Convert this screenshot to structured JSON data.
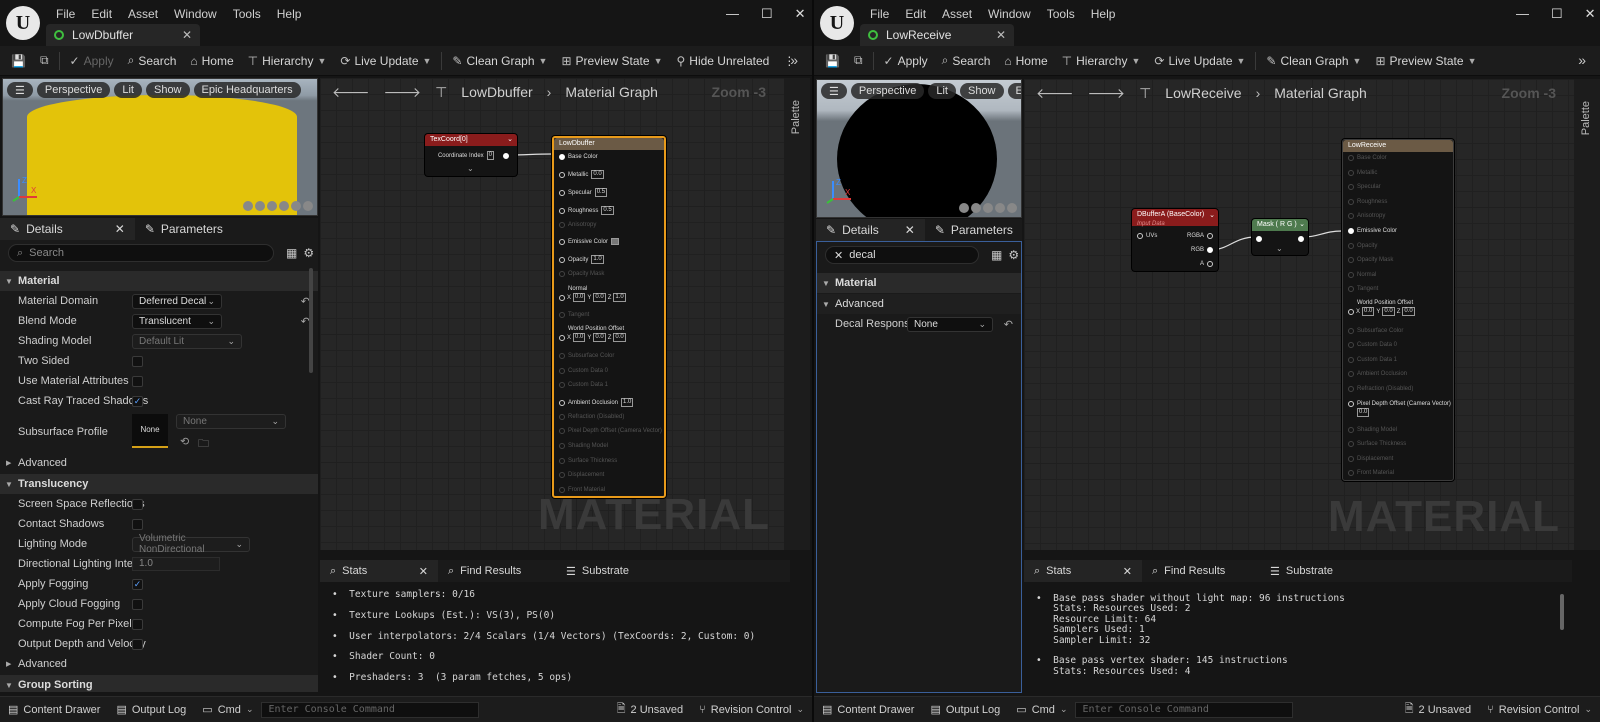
{
  "menu": [
    "File",
    "Edit",
    "Asset",
    "Window",
    "Tools",
    "Help"
  ],
  "window_controls": {
    "minimize": "—",
    "maximize": "☐",
    "close": "✕"
  },
  "left": {
    "tab_title": "LowDbuffer",
    "toolbar": {
      "apply": "Apply",
      "search": "Search",
      "home": "Home",
      "hierarchy": "Hierarchy",
      "live_update": "Live Update",
      "clean_graph": "Clean Graph",
      "preview_state": "Preview State",
      "hide_unrelated": "Hide Unrelated"
    },
    "viewport": {
      "perspective": "Perspective",
      "lit": "Lit",
      "show": "Show",
      "extra": "Epic Headquarters",
      "preview_color": "#e3c30a"
    },
    "details_tab": "Details",
    "parameters_tab": "Parameters",
    "search_placeholder": "Search",
    "cat_material": "Material",
    "material_domain_label": "Material Domain",
    "material_domain_value": "Deferred Decal",
    "blend_mode_label": "Blend Mode",
    "blend_mode_value": "Translucent",
    "shading_model_label": "Shading Model",
    "shading_model_value": "Default Lit",
    "two_sided_label": "Two Sided",
    "use_attrs_label": "Use Material Attributes",
    "cast_rt_label": "Cast Ray Traced Shadows",
    "subsurface_label": "Subsurface Profile",
    "subsurface_thumb": "None",
    "subsurface_value": "None",
    "advanced1": "Advanced",
    "cat_translucency": "Translucency",
    "ssr_label": "Screen Space Reflections",
    "contact_label": "Contact Shadows",
    "lighting_mode_label": "Lighting Mode",
    "lighting_mode_value": "Volumetric NonDirectional",
    "dir_light_label": "Directional Lighting Intensity",
    "dir_light_value": "1.0",
    "apply_fog_label": "Apply Fogging",
    "cloud_fog_label": "Apply Cloud Fogging",
    "fog_pixel_label": "Compute Fog Per Pixel",
    "output_depth_label": "Output Depth and Velocity",
    "advanced2": "Advanced",
    "cat_group_sorting": "Group Sorting",
    "breadcrumb_asset": "LowDbuffer",
    "breadcrumb_graph": "Material Graph",
    "zoom": "Zoom -3",
    "palette": "Palette",
    "watermark": "MATERIAL",
    "texcoord": {
      "title": "TexCoord[0]",
      "coordinate_index": "Coordinate Index",
      "ci_value": "0"
    },
    "main_node": {
      "title": "LowDbuffer",
      "base_color": "Base Color",
      "metallic": "Metallic",
      "metallic_v": "0.0",
      "specular": "Specular",
      "specular_v": "0.5",
      "roughness": "Roughness",
      "roughness_v": "0.5",
      "anisotropy": "Anisotropy",
      "emissive": "Emissive Color",
      "opacity": "Opacity",
      "opacity_v": "1.0",
      "opacity_mask": "Opacity Mask",
      "normal": "Normal",
      "nx": "0.0",
      "ny": "0.0",
      "nz": "1.0",
      "tangent": "Tangent",
      "wpo": "World Position Offset",
      "wx": "0.0",
      "wy": "0.0",
      "wz": "0.0",
      "subsurface": "Subsurface Color",
      "cd0": "Custom Data 0",
      "cd1": "Custom Data 1",
      "ao": "Ambient Occlusion",
      "ao_v": "1.0",
      "refraction": "Refraction (Disabled)",
      "pdo": "Pixel Depth Offset (Camera Vector)",
      "shading_model": "Shading Model",
      "surface_thickness": "Surface Thickness",
      "displacement": "Displacement",
      "front_material": "Front Material"
    },
    "stats_tab": "Stats",
    "find_tab": "Find Results",
    "substrate_tab": "Substrate",
    "stats_text": "•  Texture samplers: 0/16\n\n•  Texture Lookups (Est.): VS(3), PS(0)\n\n•  User interpolators: 2/4 Scalars (1/4 Vectors) (TexCoords: 2, Custom: 0)\n\n•  Shader Count: 0\n\n•  Preshaders: 3  (3 param fetches, 5 ops)",
    "bottom": {
      "content_drawer": "Content Drawer",
      "output_log": "Output Log",
      "cmd": "Cmd",
      "console_placeholder": "Enter Console Command",
      "unsaved": "2 Unsaved",
      "revision": "Revision Control"
    }
  },
  "right": {
    "tab_title": "LowReceive",
    "toolbar": {
      "apply": "Apply",
      "search": "Search",
      "home": "Home",
      "hierarchy": "Hierarchy",
      "live_update": "Live Update",
      "clean_graph": "Clean Graph",
      "preview_state": "Preview State"
    },
    "viewport": {
      "perspective": "Perspective",
      "lit": "Lit",
      "show": "Show",
      "extra": "E"
    },
    "details_tab": "Details",
    "parameters_tab": "Parameters",
    "search_value": "decal",
    "cat_material": "Material",
    "advanced": "Advanced",
    "decal_label": "Decal Response...",
    "decal_value": "None",
    "breadcrumb_asset": "LowReceive",
    "breadcrumb_graph": "Material Graph",
    "zoom": "Zoom -3",
    "palette": "Palette",
    "watermark": "MATERIAL",
    "dbuffer": {
      "title": "DBufferA (BaseColor)",
      "subtitle": "Input Data",
      "uvs": "UVs",
      "rgba": "RGBA",
      "rgb": "RGB",
      "a": "A"
    },
    "mask": {
      "title": "Mask ( R G )"
    },
    "main_node": {
      "title": "LowReceive",
      "base_color": "Base Color",
      "metallic": "Metallic",
      "specular": "Specular",
      "roughness": "Roughness",
      "anisotropy": "Anisotropy",
      "emissive": "Emissive Color",
      "opacity": "Opacity",
      "opacity_mask": "Opacity Mask",
      "normal": "Normal",
      "tangent": "Tangent",
      "wpo": "World Position Offset",
      "wx": "0.0",
      "wy": "0.0",
      "wz": "0.0",
      "subsurface": "Subsurface Color",
      "cd0": "Custom Data 0",
      "cd1": "Custom Data 1",
      "ao": "Ambient Occlusion",
      "refraction": "Refraction (Disabled)",
      "pdo": "Pixel Depth Offset (Camera Vector)",
      "pdo_v": "0.0",
      "shading_model": "Shading Model",
      "surface_thickness": "Surface Thickness",
      "displacement": "Displacement",
      "front_material": "Front Material"
    },
    "stats_tab": "Stats",
    "find_tab": "Find Results",
    "substrate_tab": "Substrate",
    "stats_text": "•  Base pass shader without light map: 96 instructions\n   Stats: Resources Used: 2\n   Resource Limit: 64\n   Samplers Used: 1\n   Sampler Limit: 32\n\n•  Base pass vertex shader: 145 instructions\n   Stats: Resources Used: 4",
    "bottom": {
      "content_drawer": "Content Drawer",
      "output_log": "Output Log",
      "cmd": "Cmd",
      "console_placeholder": "Enter Console Command",
      "unsaved": "2 Unsaved",
      "revision": "Revision Control"
    }
  }
}
